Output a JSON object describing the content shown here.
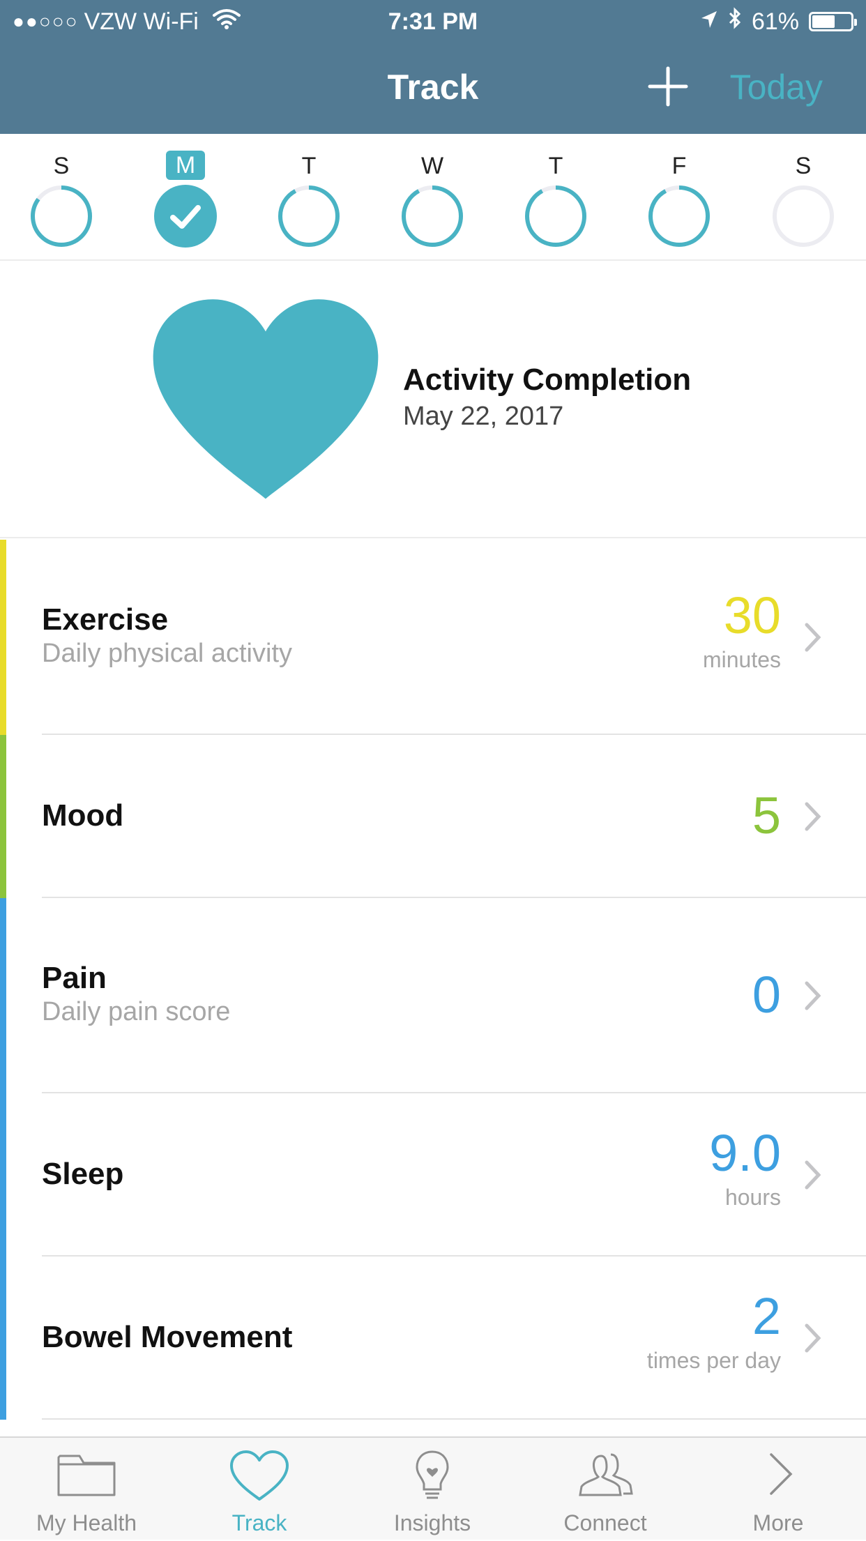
{
  "status_bar": {
    "signal": "●●○○○",
    "carrier": "VZW Wi-Fi",
    "time": "7:31 PM",
    "battery": "61%",
    "battery_level": 0.61
  },
  "nav": {
    "title": "Track",
    "today_label": "Today"
  },
  "week": {
    "days": [
      {
        "letter": "S",
        "progress": 0.85,
        "state": "partial"
      },
      {
        "letter": "M",
        "progress": 1.0,
        "state": "selected"
      },
      {
        "letter": "T",
        "progress": 0.92,
        "state": "partial"
      },
      {
        "letter": "W",
        "progress": 0.92,
        "state": "partial"
      },
      {
        "letter": "T",
        "progress": 0.92,
        "state": "partial"
      },
      {
        "letter": "F",
        "progress": 0.92,
        "state": "partial"
      },
      {
        "letter": "S",
        "progress": 0.0,
        "state": "empty"
      }
    ],
    "ring_color": "#49b3c4",
    "track_color": "#ececf1"
  },
  "completion": {
    "title": "Activity Completion",
    "date": "May 22, 2017",
    "heart_color": "#49b3c4"
  },
  "metrics": [
    {
      "name": "Exercise",
      "desc": "Daily physical activity",
      "value": "30",
      "unit": "minutes",
      "color": "#e8dc2a"
    },
    {
      "name": "Mood",
      "desc": "",
      "value": "5",
      "unit": "",
      "color": "#8cc43c"
    },
    {
      "name": "Pain",
      "desc": "Daily pain score",
      "value": "0",
      "unit": "",
      "color": "#3d9fe0"
    },
    {
      "name": "Sleep",
      "desc": "",
      "value": "9.0",
      "unit": "hours",
      "color": "#3d9fe0"
    },
    {
      "name": "Bowel Movement",
      "desc": "",
      "value": "2",
      "unit": "times per day",
      "color": "#3d9fe0"
    }
  ],
  "tabs": [
    {
      "label": "My Health",
      "icon": "folder-icon",
      "active": false
    },
    {
      "label": "Track",
      "icon": "heart-icon",
      "active": true
    },
    {
      "label": "Insights",
      "icon": "lightbulb-icon",
      "active": false
    },
    {
      "label": "Connect",
      "icon": "people-icon",
      "active": false
    },
    {
      "label": "More",
      "icon": "chevron-right-icon",
      "active": false
    }
  ]
}
